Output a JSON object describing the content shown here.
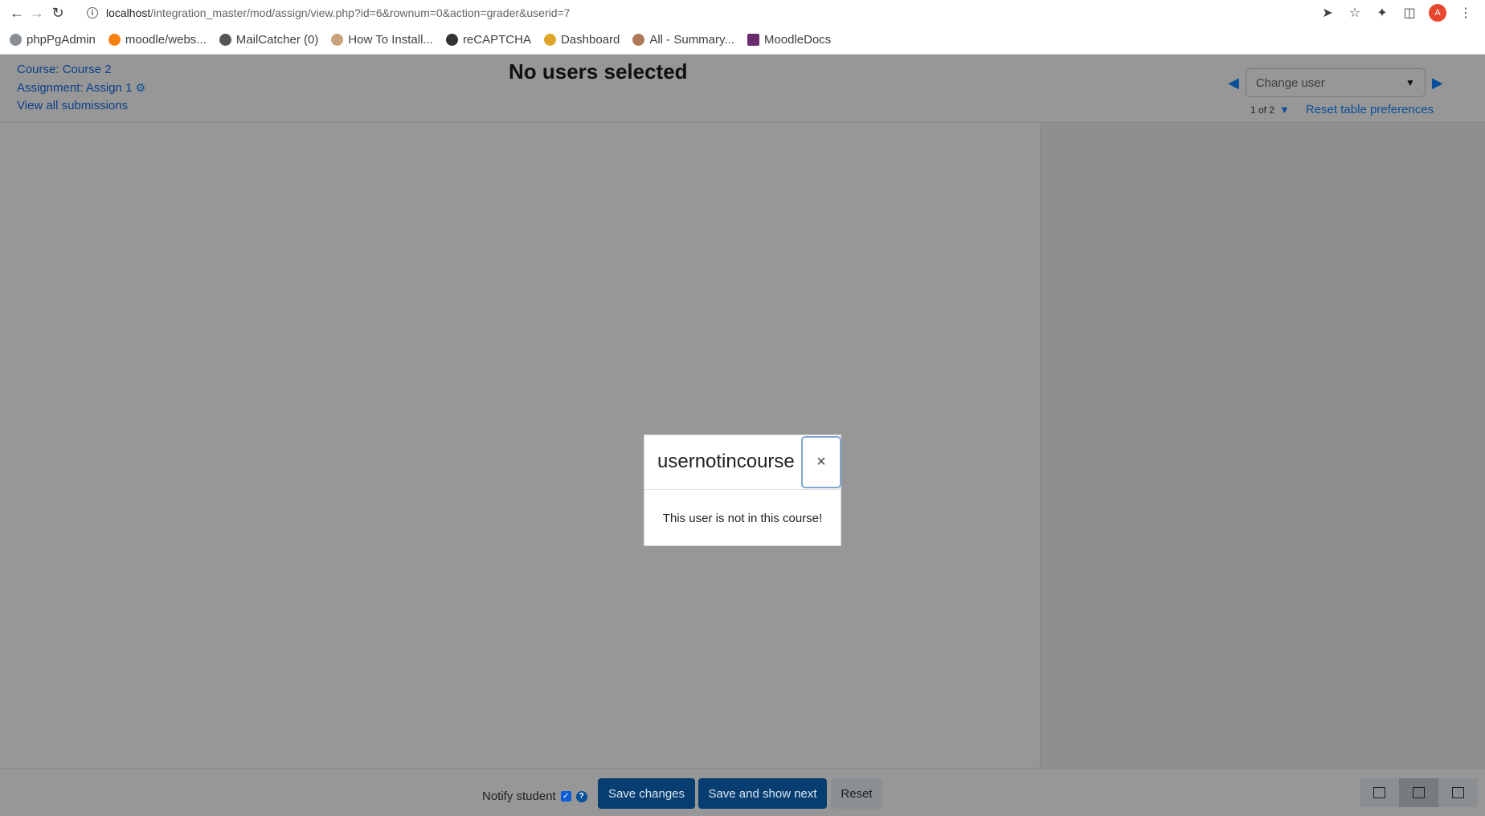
{
  "browser": {
    "url_host": "localhost",
    "url_path": "/integration_master/mod/assign/view.php?id=6&rownum=0&action=grader&userid=7",
    "avatar_letter": "A",
    "bookmarks": [
      "phpPgAdmin",
      "moodle/webs...",
      "MailCatcher (0)",
      "How To Install...",
      "reCAPTCHA",
      "Dashboard",
      "All - Summary...",
      "MoodleDocs"
    ]
  },
  "header": {
    "course_link": "Course: Course 2",
    "assignment_link": "Assignment: Assign 1",
    "view_all": "View all submissions",
    "title": "No users selected",
    "change_user_placeholder": "Change user",
    "pager": "1 of 2",
    "reset_prefs": "Reset table preferences"
  },
  "modal": {
    "title": "usernotincourse",
    "close": "×",
    "message": "This user is not in this course!"
  },
  "footer": {
    "notify_label": "Notify student",
    "save_changes": "Save changes",
    "save_and_next": "Save and show next",
    "reset": "Reset"
  },
  "colors": {
    "overlay_bg": "#979797",
    "primary_button": "#073e72",
    "link": "#0a4f99"
  }
}
